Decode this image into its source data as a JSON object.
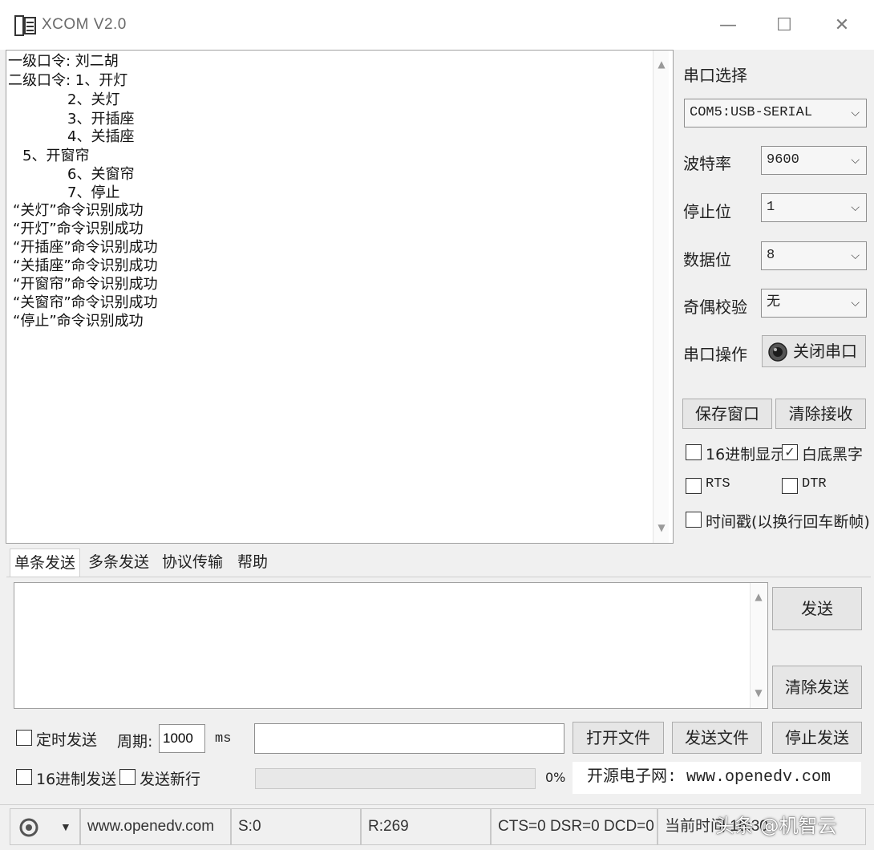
{
  "window": {
    "title": "XCOM V2.0",
    "minimize": "—",
    "maximize": "☐",
    "close": "✕"
  },
  "receive": {
    "lines": [
      "一级口令: 刘二胡",
      "二级口令: 1、开灯",
      "2、关灯",
      "3、开插座",
      "4、关插座",
      "5、开窗帘",
      "6、关窗帘",
      "7、停止",
      "“关灯”命令识别成功",
      "“开灯”命令识别成功",
      "“开插座”命令识别成功",
      "“关插座”命令识别成功",
      "“开窗帘”命令识别成功",
      "“关窗帘”命令识别成功",
      "“停止”命令识别成功"
    ]
  },
  "side": {
    "port_select_label": "串口选择",
    "port_value": "COM5:USB-SERIAL",
    "baud_label": "波特率",
    "baud_value": "9600",
    "stopbit_label": "停止位",
    "stopbit_value": "1",
    "databit_label": "数据位",
    "databit_value": "8",
    "parity_label": "奇偶校验",
    "parity_value": "无",
    "port_op_label": "串口操作",
    "close_port_button": "关闭串口",
    "save_window_button": "保存窗口",
    "clear_recv_button": "清除接收",
    "hex_display": "16进制显示",
    "white_bg": "白底黑字",
    "rts": "RTS",
    "dtr": "DTR",
    "timestamp": "时间戳(以换行回车断帧)"
  },
  "tabs": [
    "单条发送",
    "多条发送",
    "协议传输",
    "帮助"
  ],
  "send": {
    "send_button": "发送",
    "clear_send_button": "清除发送",
    "timed_send": "定时发送",
    "period_label": "周期:",
    "period_value": "1000",
    "ms": "ms",
    "open_file_button": "打开文件",
    "send_file_button": "发送文件",
    "stop_send_button": "停止发送",
    "hex_send": "16进制发送",
    "send_newline": "发送新行",
    "progress_text": "0%",
    "progress": 0,
    "brand": "开源电子网: www.openedv.com"
  },
  "status": {
    "site": "www.openedv.com",
    "sent": "S:0",
    "received": "R:269",
    "signals": "CTS=0 DSR=0 DCD=0",
    "time": "当前时间 16:30"
  },
  "watermark": "头条 @机智云"
}
